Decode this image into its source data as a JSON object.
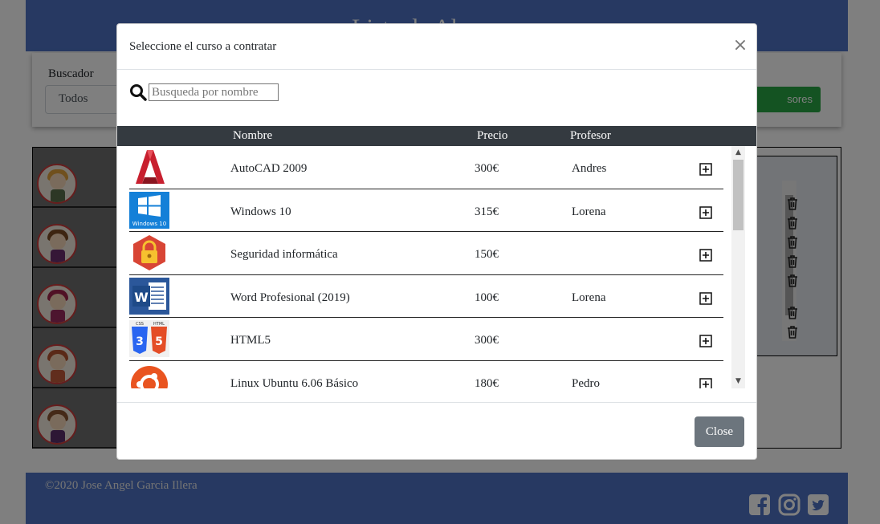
{
  "background": {
    "header_title": "Lista de Alumnos",
    "search_label": "Buscador",
    "filter_value": "Todos",
    "green_button_label": "sores",
    "footer_text": "©2020 Jose Angel Garcia Illera",
    "accent_color": "#4e73c4"
  },
  "modal": {
    "title": "Seleccione el curso a contratar",
    "close_x": "×",
    "search_placeholder": "Busqueda por nombre",
    "columns": {
      "name": "Nombre",
      "price": "Precio",
      "teacher": "Profesor"
    },
    "courses": [
      {
        "icon": "autocad-icon",
        "name": "AutoCAD 2009",
        "price": "300€",
        "teacher": "Andres"
      },
      {
        "icon": "windows10-icon",
        "name": "Windows 10",
        "price": "315€",
        "teacher": "Lorena",
        "icon_caption": "Windows 10"
      },
      {
        "icon": "security-lock-icon",
        "name": "Seguridad informática",
        "price": "150€",
        "teacher": ""
      },
      {
        "icon": "word-icon",
        "name": "Word Profesional (2019)",
        "price": "100€",
        "teacher": "Lorena"
      },
      {
        "icon": "html5-css3-icon",
        "name": "HTML5",
        "price": "300€",
        "teacher": ""
      },
      {
        "icon": "ubuntu-icon",
        "name": "Linux Ubuntu 6.06 Básico",
        "price": "180€",
        "teacher": "Pedro"
      }
    ],
    "close_button_label": "Close"
  }
}
